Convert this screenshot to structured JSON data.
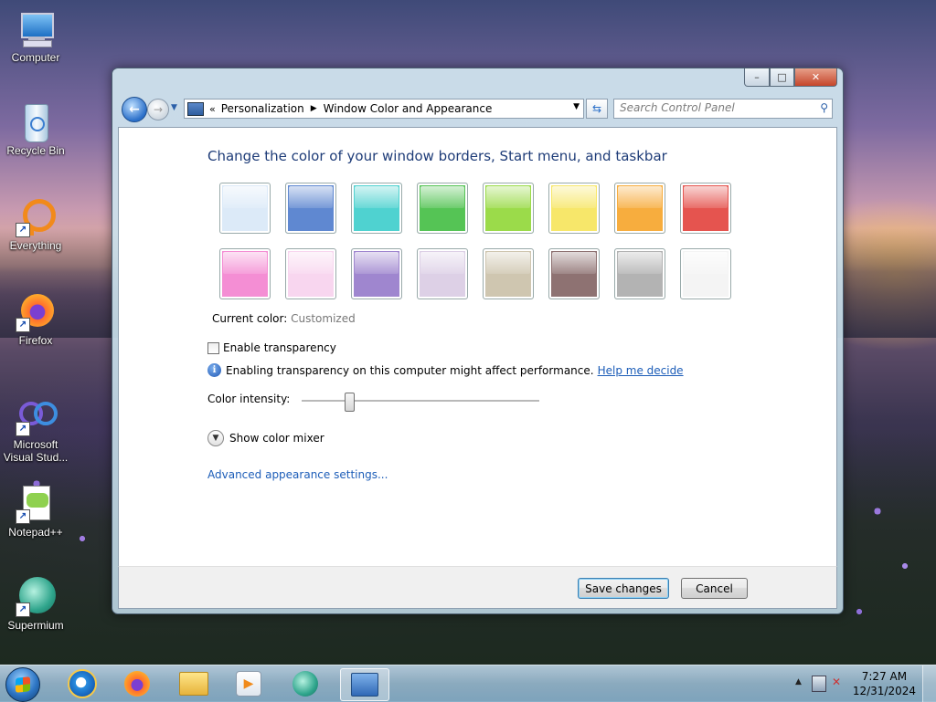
{
  "desktop": {
    "icons": [
      {
        "label": "Computer",
        "icon": "computer-icon"
      },
      {
        "label": "Recycle Bin",
        "icon": "recycle-bin-icon"
      },
      {
        "label": "Everything",
        "icon": "everything-icon"
      },
      {
        "label": "Firefox",
        "icon": "firefox-icon"
      },
      {
        "label": "Microsoft Visual Stud...",
        "icon": "visual-studio-icon"
      },
      {
        "label": "Notepad++",
        "icon": "notepadpp-icon"
      },
      {
        "label": "Supermium",
        "icon": "supermium-icon"
      }
    ]
  },
  "window": {
    "caption": {
      "minimize": "–",
      "maximize": "□",
      "close": "✕"
    },
    "address": {
      "prefix": "«",
      "crumbs": [
        "Personalization",
        "Window Color and Appearance"
      ]
    },
    "search_placeholder": "Search Control Panel",
    "heading": "Change the color of your window borders, Start menu, and taskbar",
    "swatches": [
      {
        "name": "sky",
        "color": "#dceaf8"
      },
      {
        "name": "twilight",
        "color": "#5f88d1"
      },
      {
        "name": "sea",
        "color": "#4fd2d0"
      },
      {
        "name": "leaf",
        "color": "#55c455"
      },
      {
        "name": "lime",
        "color": "#9bdb4a"
      },
      {
        "name": "lemon",
        "color": "#f7e76a"
      },
      {
        "name": "pumpkin",
        "color": "#f7ad3e"
      },
      {
        "name": "ruby",
        "color": "#e5544f"
      },
      {
        "name": "fuchsia",
        "color": "#f48ed4"
      },
      {
        "name": "blush",
        "color": "#f8d6ef"
      },
      {
        "name": "violet",
        "color": "#9f86cf"
      },
      {
        "name": "lavender",
        "color": "#ddd0e6"
      },
      {
        "name": "taupe",
        "color": "#cfc6b0"
      },
      {
        "name": "chocolate",
        "color": "#8e7272"
      },
      {
        "name": "slate",
        "color": "#b3b3b3"
      },
      {
        "name": "frost",
        "color": "#f4f4f4"
      }
    ],
    "current_color_label": "Current color:",
    "current_color_value": "Customized",
    "transparency_label": "Enable transparency",
    "transparency_checked": false,
    "info_text": "Enabling transparency on this computer might affect performance.",
    "help_link": "Help me decide",
    "intensity_label": "Color intensity:",
    "intensity_value": 0.2,
    "mixer_label": "Show color mixer",
    "advanced_link": "Advanced appearance settings...",
    "save_label": "Save changes",
    "cancel_label": "Cancel"
  },
  "taskbar": {
    "items": [
      "internet-explorer-icon",
      "firefox-icon",
      "file-explorer-icon",
      "media-player-icon",
      "supermium-icon",
      "control-panel-icon"
    ],
    "time": "7:27 AM",
    "date": "12/31/2024"
  }
}
